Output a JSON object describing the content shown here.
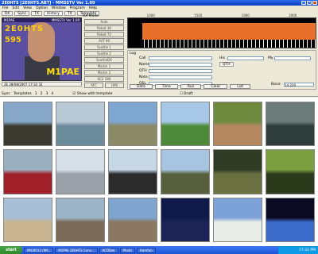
{
  "window": {
    "title": "2E0HTS [2E0HTS.ABT] - MMSSTV Ver 1.09"
  },
  "menu": [
    "File",
    "Edit",
    "View",
    "Option",
    "Window",
    "Program",
    "Help"
  ],
  "toolbar": [
    "RX",
    "Sync",
    "TX",
    "History",
    "TX",
    "Template"
  ],
  "rx_image": {
    "header_left": "M1PAE",
    "header_right": "MMSSTV Ver 1.09",
    "call1": "2E0HTS",
    "call2": "595",
    "call3": "M1PAE"
  },
  "rx_bar": {
    "text": "2E 28/08/2007 17:33 32"
  },
  "mode_panel": {
    "title": "RX Mode",
    "buttons": [
      "Auto",
      "Robot 36",
      "Robot 72",
      "AVT 90",
      "Scottie 1",
      "Scottie 2",
      "ScottieDX",
      "Martin 1",
      "Martin 2",
      "SC2 180"
    ],
    "foot": [
      "AFC",
      "LMS"
    ]
  },
  "freqscale": [
    "1000",
    "1500",
    "1900",
    "2000"
  ],
  "log": {
    "title": "Log",
    "labels": [
      "Call",
      "Name",
      "QTH",
      "Note",
      "QSL",
      "His",
      "My",
      "Band"
    ],
    "qth_btn": "QTH",
    "band_value": "14.230"
  },
  "log_buttons": [
    "Data",
    "Time",
    "Run",
    "Clear",
    "List"
  ],
  "tabs": {
    "first": "Sync",
    "items": [
      "Templates",
      "1",
      "2",
      "3",
      "4"
    ],
    "show_with_template": "Show with template",
    "draft": "Draft"
  },
  "taskbar": {
    "start": "start",
    "tasks": [
      "IMG0013 (M6..",
      "M1PAE 2E0HTS Conv...",
      "ACDSee",
      "Photo",
      "Hamfan"
    ],
    "clock": "17:32 PM"
  },
  "gallery": [
    {
      "top": "#87a8c8",
      "bottom": "#3c3a30"
    },
    {
      "top": "#b9c9d6",
      "bottom": "#6b8a9a"
    },
    {
      "top": "#7fa6d0",
      "bottom": "#8a8a68"
    },
    {
      "top": "#a6c7e6",
      "bottom": "#4f8a3a"
    },
    {
      "top": "#6e8a3f",
      "bottom": "#b48860"
    },
    {
      "top": "#6a7b7a",
      "bottom": "#2f3d3a"
    },
    {
      "top": "#9bb0c0",
      "bottom": "#a0202a"
    },
    {
      "top": "#d7e0e8",
      "bottom": "#9aa0a8"
    },
    {
      "top": "#c6d7e6",
      "bottom": "#2c2b2c"
    },
    {
      "top": "#a7c5e0",
      "bottom": "#56603c"
    },
    {
      "top": "#2f3b25",
      "bottom": "#6b7040"
    },
    {
      "top": "#7b9e3e",
      "bottom": "#2a3a1a"
    },
    {
      "top": "#a8bfd8",
      "bottom": "#c8b490"
    },
    {
      "top": "#9cb4c8",
      "bottom": "#7a6a58"
    },
    {
      "top": "#7fa5cf",
      "bottom": "#8a7862"
    },
    {
      "top": "#0f1a4a",
      "bottom": "#1b2454"
    },
    {
      "top": "#7da2d8",
      "bottom": "#e8ece8"
    },
    {
      "top": "#0a0a22",
      "bottom": "#3c6ac8"
    }
  ]
}
